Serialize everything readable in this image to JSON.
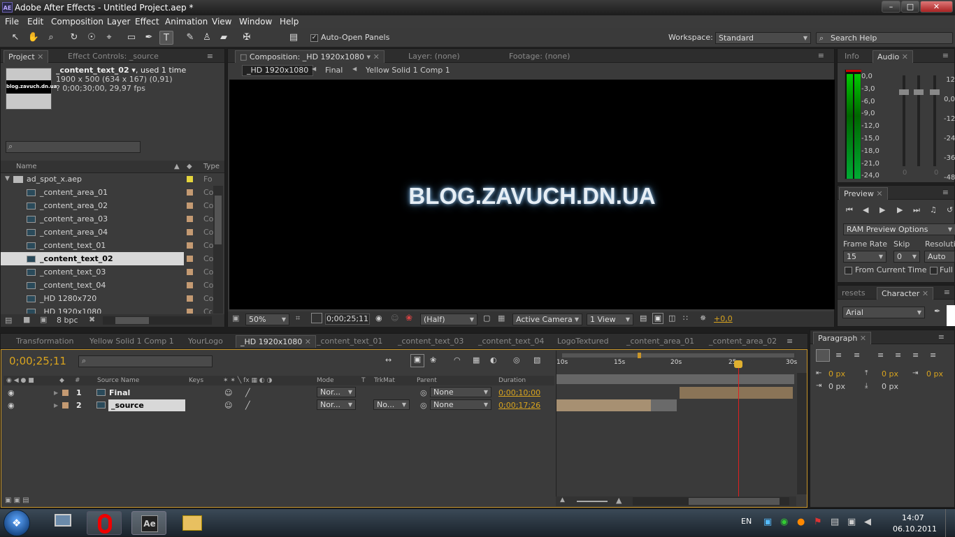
{
  "app": {
    "icon": "AE",
    "title": "Adobe After Effects - Untitled Project.aep *"
  },
  "window_controls": {
    "minimize": "–",
    "maximize": "□",
    "close": "✕"
  },
  "menu": [
    "File",
    "Edit",
    "Composition",
    "Layer",
    "Effect",
    "Animation",
    "View",
    "Window",
    "Help"
  ],
  "toolbar": {
    "auto_open_label": "Auto-Open Panels",
    "workspace_label": "Workspace:",
    "workspace_value": "Standard",
    "search_placeholder": "Search Help"
  },
  "project": {
    "tab_project": "Project",
    "tab_effect_controls": "Effect Controls: _source",
    "item_name": "_content_text_02 ▾",
    "item_used": ", used 1 time",
    "item_dims": "1900 x 500  (634 x 167) (0,91)",
    "item_duration": "? 0;00;30;00, 29,97 fps",
    "thumb_text": "blog.zavuch.dn.ua",
    "col_name": "Name",
    "col_type": "Type",
    "folder": "ad_spot_x.aep",
    "folder_type": "Fo",
    "items": [
      {
        "name": "_content_area_01",
        "type": "Co"
      },
      {
        "name": "_content_area_02",
        "type": "Co"
      },
      {
        "name": "_content_area_03",
        "type": "Co"
      },
      {
        "name": "_content_area_04",
        "type": "Co"
      },
      {
        "name": "_content_text_01",
        "type": "Co"
      },
      {
        "name": "_content_text_02",
        "type": "Co"
      },
      {
        "name": "_content_text_03",
        "type": "Co"
      },
      {
        "name": "_content_text_04",
        "type": "Co"
      },
      {
        "name": "_HD 1280x720",
        "type": "Co"
      },
      {
        "name": "_HD 1920x1080",
        "type": "Co"
      }
    ],
    "bpc": "8 bpc"
  },
  "composition": {
    "tab_comp": "Composition: _HD 1920x1080",
    "tab_layer": "Layer: (none)",
    "tab_footage": "Footage: (none)",
    "crumbs": [
      "_HD 1920x1080",
      "Final",
      "Yellow Solid 1 Comp 1"
    ],
    "viewer_text": "BLOG.ZAVUCH.DN.UA",
    "zoom": "50%",
    "timecode": "0;00;25;11",
    "resolution": "(Half)",
    "camera": "Active Camera",
    "views": "1 View",
    "exposure": "+0,0"
  },
  "info_audio": {
    "tab_info": "Info",
    "tab_audio": "Audio",
    "db_left": [
      "0,0",
      "-3,0",
      "-6,0",
      "-9,0",
      "-12,0",
      "-15,0",
      "-18,0",
      "-21,0",
      "-24,0"
    ],
    "db_right": [
      "12",
      "0,0",
      "-12",
      "-24",
      "-36",
      "-48"
    ],
    "zero": "0"
  },
  "preview": {
    "tab": "Preview",
    "ram_options": "RAM Preview Options",
    "frame_rate_label": "Frame Rate",
    "skip_label": "Skip",
    "resolution_label": "Resolutio",
    "frame_rate": "15",
    "skip": "0",
    "resolution": "Auto",
    "from_current": "From Current Time",
    "full": "Full"
  },
  "character": {
    "tab_presets": "resets",
    "tab_character": "Character",
    "font": "Arial"
  },
  "paragraph": {
    "tab": "Paragraph",
    "px": "0 px"
  },
  "timeline": {
    "tabs": [
      "Transformation",
      "Yellow Solid 1 Comp 1",
      "YourLogo",
      "_HD 1920x1080",
      "_content_text_01",
      "_content_text_03",
      "_content_text_04",
      "LogoTextured",
      "_content_area_01",
      "_content_area_02"
    ],
    "timecode": "0;00;25;11",
    "headers": {
      "num": "#",
      "source": "Source Name",
      "keys": "Keys",
      "mode": "Mode",
      "t": "T",
      "trkmat": "TrkMat",
      "parent": "Parent",
      "duration": "Duration"
    },
    "ruler": [
      "10s",
      "15s",
      "20s",
      "25s",
      "30s"
    ],
    "layers": [
      {
        "num": "1",
        "name": "Final",
        "mode": "Nor...",
        "trkmat": "",
        "parent": "None",
        "duration": "0;00;10;00"
      },
      {
        "num": "2",
        "name": "_source",
        "mode": "Nor...",
        "trkmat": "No...",
        "parent": "None",
        "duration": "0;00;17;26"
      }
    ]
  },
  "taskbar": {
    "lang": "EN",
    "time": "14:07",
    "date": "06.10.2011",
    "ae_label": "Ae"
  },
  "colors": {
    "accent": "#d9a41e",
    "panel": "#3b3b3b",
    "playhead": "#e02020"
  }
}
